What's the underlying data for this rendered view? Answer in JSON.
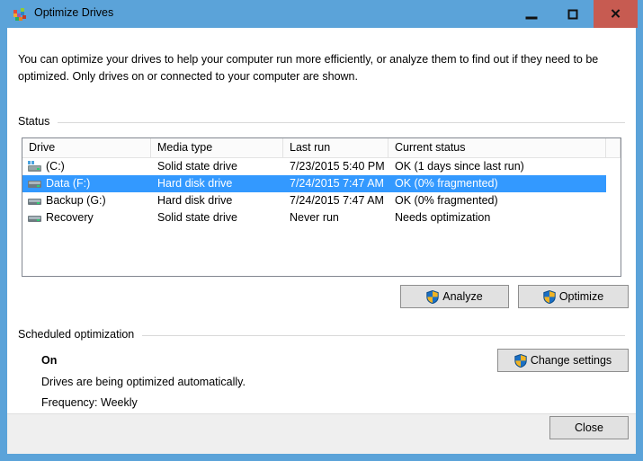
{
  "window": {
    "title": "Optimize Drives",
    "title_icon": "defrag-blocks-icon",
    "accent_color": "#5ba3d9",
    "close_color": "#c75b51",
    "selection_color": "#3399ff"
  },
  "caption_buttons": {
    "minimize": "minimize-icon",
    "maximize": "maximize-icon",
    "close": "✕",
    "close_label": "Close"
  },
  "intro": {
    "text": "You can optimize your drives to help your computer run more efficiently, or analyze them to find out if they need to be optimized. Only drives on or connected to your computer are shown."
  },
  "groups": {
    "status_label": "Status",
    "scheduled_label": "Scheduled optimization"
  },
  "drive_list": {
    "columns": [
      "Drive",
      "Media type",
      "Last run",
      "Current status",
      ""
    ],
    "rows": [
      {
        "drive": "(C:)",
        "media_type": "Solid state drive",
        "last_run": "7/23/2015 5:40 PM",
        "current_status": "OK (1 days since last run)",
        "icon": "system-drive-icon",
        "selected": false
      },
      {
        "drive": "Data (F:)",
        "media_type": "Hard disk drive",
        "last_run": "7/24/2015 7:47 AM",
        "current_status": "OK (0% fragmented)",
        "icon": "drive-icon",
        "selected": true
      },
      {
        "drive": "Backup (G:)",
        "media_type": "Hard disk drive",
        "last_run": "7/24/2015 7:47 AM",
        "current_status": "OK (0% fragmented)",
        "icon": "drive-icon",
        "selected": false
      },
      {
        "drive": "Recovery",
        "media_type": "Solid state drive",
        "last_run": "Never run",
        "current_status": "Needs optimization",
        "icon": "drive-icon",
        "selected": false
      }
    ]
  },
  "buttons": {
    "analyze": "Analyze",
    "optimize": "Optimize",
    "change_settings": "Change settings",
    "close": "Close"
  },
  "scheduled": {
    "state": "On",
    "description": "Drives are being optimized automatically.",
    "frequency": "Frequency: Weekly"
  }
}
